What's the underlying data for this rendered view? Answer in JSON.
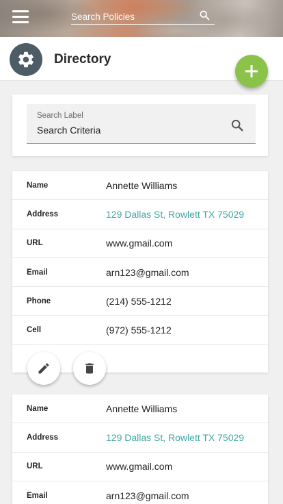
{
  "appbar": {
    "search_placeholder": "Search Policies",
    "menu_icon": "hamburger-menu-icon",
    "search_icon": "search-icon"
  },
  "header": {
    "title": "Directory",
    "badge_icon": "gear-icon",
    "fab_icon": "plus-icon",
    "fab_color": "#8bc34a",
    "badge_color": "#4e5c66"
  },
  "search_card": {
    "label": "Search Label",
    "value": "Search Criteria",
    "icon": "search-icon"
  },
  "accent_link_color": "#3fa7a3",
  "records": [
    {
      "fields": [
        {
          "key": "Name",
          "value": "Annette Williams"
        },
        {
          "key": "Address",
          "value": "129 Dallas St, Rowlett TX 75029"
        },
        {
          "key": "URL",
          "value": "www.gmail.com"
        },
        {
          "key": "Email",
          "value": "arn123@gmail.com"
        },
        {
          "key": "Phone",
          "value": "(214) 555-1212"
        },
        {
          "key": "Cell",
          "value": "(972) 555-1212"
        }
      ],
      "actions": [
        "edit-icon",
        "delete-icon"
      ]
    },
    {
      "fields": [
        {
          "key": "Name",
          "value": "Annette Williams"
        },
        {
          "key": "Address",
          "value": "129 Dallas St, Rowlett TX 75029"
        },
        {
          "key": "URL",
          "value": "www.gmail.com"
        },
        {
          "key": "Email",
          "value": "arn123@gmail.com"
        }
      ]
    }
  ]
}
